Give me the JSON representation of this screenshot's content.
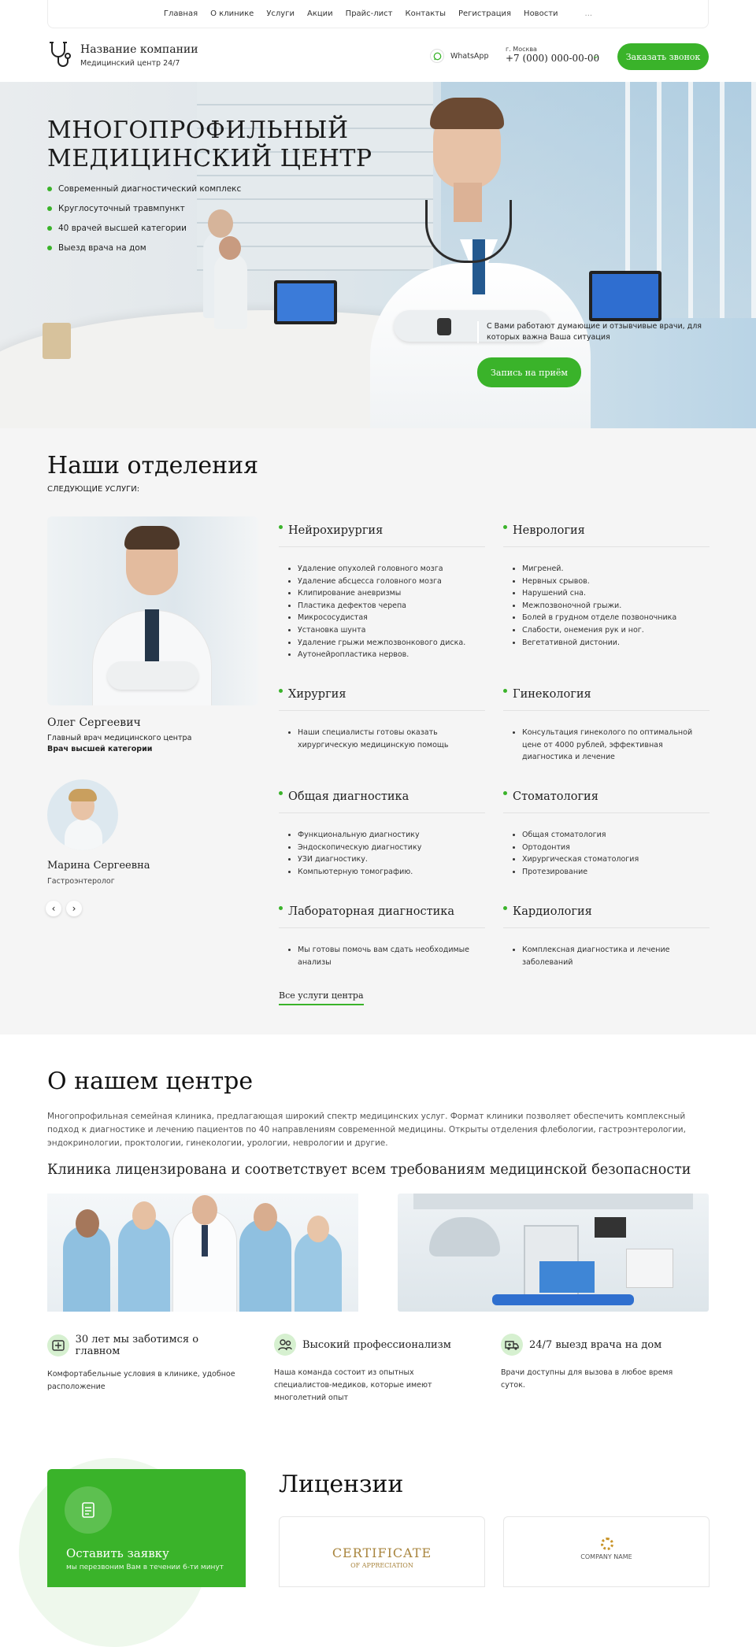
{
  "nav": {
    "items": [
      "Главная",
      "О клинике",
      "Услуги",
      "Акции",
      "Прайс-лист",
      "Контакты",
      "Регистрация",
      "Новости"
    ],
    "more": "..."
  },
  "header": {
    "company": "Название компании",
    "tagline": "Медицинский центр 24/7",
    "whatsapp": "WhatsApp",
    "city": "г. Москва",
    "phone": "+7 (000) 000-00-00",
    "callback": "Заказать звонок"
  },
  "hero": {
    "title_line1": "МНОГОПРОФИЛЬНЫЙ",
    "title_line2": "МЕДИЦИНСКИЙ ЦЕНТР",
    "bullets": [
      "Современный диагностический комплекс",
      "Круглосуточный травмпункт",
      "40 врачей высшей категории",
      "Выезд врача на дом"
    ],
    "note": "С Вами работают думающие и отзывчивые врачи, для которых важна Ваша ситуация",
    "cta": "Запись на приём"
  },
  "departments": {
    "title": "Наши отделения",
    "subtitle": "СЛЕДУЮЩИЕ УСЛУГИ:",
    "doctor1": {
      "name": "Олег Сергеевич",
      "role": "Главный врач медицинского центра",
      "grade": "Врач высшей категории"
    },
    "doctor2": {
      "name": "Марина Сергеевна",
      "role": "Гастроэнтеролог"
    },
    "items": [
      {
        "title": "Нейрохирургия",
        "list": [
          "Удаление опухолей головного мозга",
          "Удаление абсцесса головного мозга",
          "Клипирование аневризмы",
          "Пластика дефектов черепа",
          "Микрососудистая",
          "Установка шунта",
          "Удаление грыжи межпозвонкового диска.",
          "Аутонейропластика нервов."
        ]
      },
      {
        "title": "Неврология",
        "list": [
          "Мигреней.",
          "Нервных срывов.",
          "Нарушений сна.",
          "Межпозвоночной грыжи.",
          "Болей в грудном отделе позвоночника",
          "Слабости, онемения рук и ног.",
          "Вегетативной дистонии."
        ]
      },
      {
        "title": "Хирургия",
        "list": [
          "Наши специалисты готовы оказать хирургическую медицинскую помощь"
        ]
      },
      {
        "title": "Гинекология",
        "list": [
          "Консультация гинеколого по оптимальной цене от 4000 рублей, эффективная диагностика и лечение"
        ]
      },
      {
        "title": "Общая диагностика",
        "list": [
          "Функциональную диагностику",
          "Эндоскопическую диагностику",
          "УЗИ диагностику.",
          "Компьютерную томографию."
        ]
      },
      {
        "title": "Стоматология",
        "list": [
          "Общая стоматология",
          "Ортодонтия",
          "Хирургическая стоматология",
          "Протезирование"
        ]
      },
      {
        "title": "Лабораторная диагностика",
        "list": [
          "Мы готовы помочь вам сдать необходимые анализы"
        ]
      },
      {
        "title": "Кардиология",
        "list": [
          "Комплексная диагностика и лечение заболеваний"
        ]
      }
    ],
    "all_link": "Все услуги центра"
  },
  "about": {
    "title": "О нашем центре",
    "text": "Многопрофильная семейная клиника, предлагающая широкий спектр медицинских услуг. Формат клиники позволяет обеспечить комплексный подход к диагностике и лечению пациентов по 40 направлениям современной медицины. Открыты отделения флебологии, гастроэнтерологии, эндокринологии, проктологии, гинекологии, урологии, неврологии и другие.",
    "license_title": "Клиника лицензирована и соответствует всем требованиям медицинской безопасности",
    "features": [
      {
        "title": "30 лет мы заботимся о главном",
        "text": "Комфортабельные условия в клинике, удобное расположение"
      },
      {
        "title": "Высокий профессионализм",
        "text": "Наша команда состоит из опытных специалистов-медиков, которые имеют многолетний опыт"
      },
      {
        "title": "24/7 выезд врача на дом",
        "text": "Врачи доступны для вызова в любое время суток."
      }
    ]
  },
  "request": {
    "title": "Оставить заявку",
    "text": "мы перезвоним Вам в течении 6-ти минут"
  },
  "licenses": {
    "title": "Лицензии",
    "cert_title": "CERTIFICATE",
    "cert_sub": "OF APPRECIATION",
    "company": "COMPANY NAME"
  },
  "colors": {
    "accent": "#3ab32a",
    "section_bg": "#f5f5f5"
  }
}
